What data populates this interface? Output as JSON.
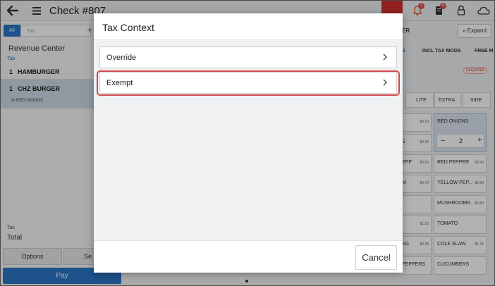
{
  "topbar": {
    "back_icon": "arrow-back-icon",
    "menu_icon": "hamburger-menu-icon",
    "check_title": "Check #807",
    "bell_badge": "1",
    "doc_badge": "4",
    "icons": [
      "bell-icon",
      "document-icon",
      "lock-icon",
      "cloud-icon"
    ]
  },
  "left_panel": {
    "seg_all": "All",
    "seg_tab": "Tab",
    "revenue_center": "Revenue Center",
    "revenue_sub": "Tab",
    "items": [
      {
        "qty": "1",
        "name": "HAMBURGER"
      },
      {
        "qty": "1",
        "name": "CHZ BURGER"
      }
    ],
    "modifier": "2x RED ONIONS",
    "tax_label": "Tax",
    "total_label": "Total",
    "options_button": "Options",
    "second_button": "Se",
    "pay_button": "Pay"
  },
  "right_panel": {
    "title": "ER",
    "expand": "Expand",
    "chips": [
      "S",
      "INCL TAX MODS",
      "FREE M"
    ],
    "required": "REQUIRED",
    "size_buttons": [
      "LITE",
      "EXTRA",
      "SIDE"
    ],
    "left_col": [
      {
        "label": "",
        "price": "$0.10"
      },
      {
        "label": "S",
        "price": "$0.30"
      },
      {
        "label": "EPP",
        "price": "$0.50"
      },
      {
        "label": "M",
        "price": "$0.70"
      },
      {
        "label": "",
        "price": ""
      },
      {
        "label": "",
        "price": "$1.50"
      },
      {
        "label": "EG",
        "price": "$0.25"
      },
      {
        "label": "PEPPERS",
        "price": ""
      }
    ],
    "right_col": [
      {
        "label": "RED ONIONS",
        "price": ""
      },
      {
        "label": "RED PEPPER",
        "price": "$0.40"
      },
      {
        "label": "YELLOW PEP...",
        "price": "$0.60"
      },
      {
        "label": "MUSHROOMS",
        "price": "$0.80"
      },
      {
        "label": "TOMATO",
        "price": ""
      },
      {
        "label": "COLE SLAW",
        "price": "$1.25"
      },
      {
        "label": "CUCUMBERS",
        "price": ""
      }
    ],
    "stepper_value": "2"
  },
  "dialog": {
    "title": "Tax Context",
    "options": [
      "Override",
      "Exempt"
    ],
    "cancel": "Cancel"
  }
}
